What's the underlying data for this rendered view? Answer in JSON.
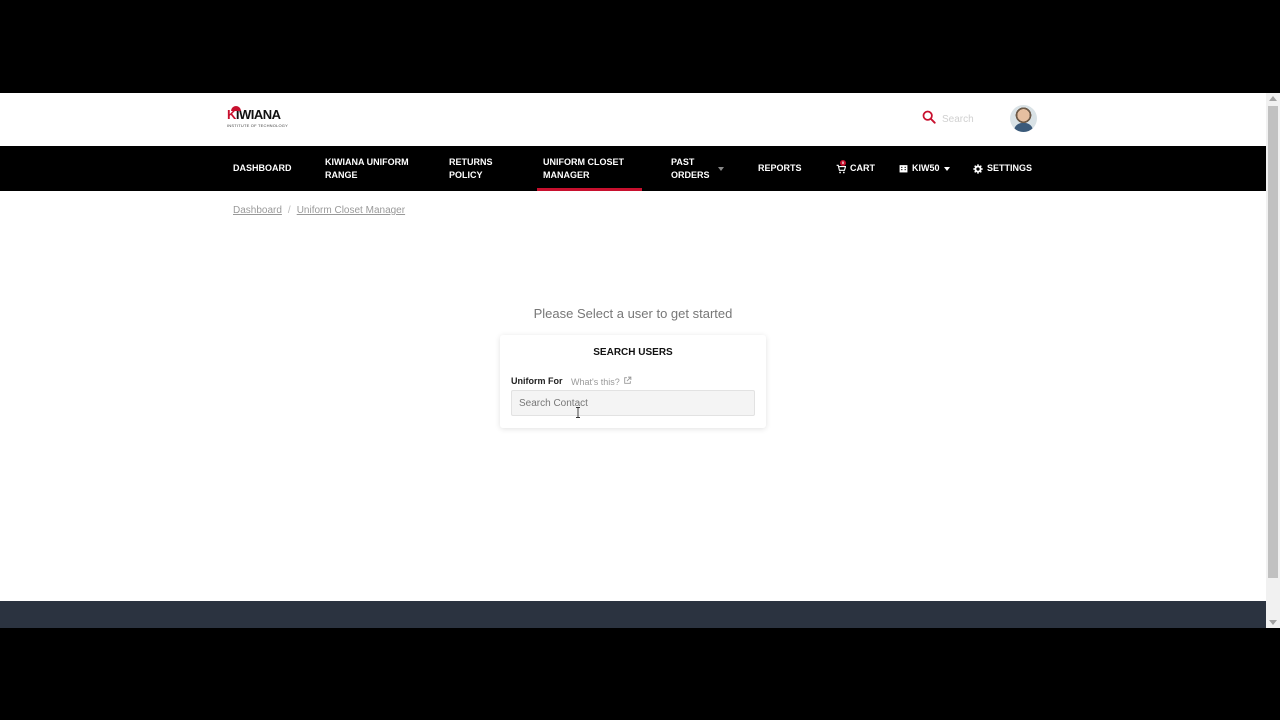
{
  "brand": {
    "name_k": "K",
    "name_rest": "IWIANA",
    "tagline": "INSTITUTE OF TECHNOLOGY",
    "accent": "#c8102e"
  },
  "header": {
    "search_placeholder": "Search",
    "search_icon": "search-icon",
    "avatar": "user-avatar"
  },
  "nav": {
    "items": [
      {
        "label": "DASHBOARD"
      },
      {
        "label": "KIWIANA UNIFORM\nRANGE"
      },
      {
        "label": "RETURNS\nPOLICY"
      },
      {
        "label": "UNIFORM CLOSET\nMANAGER",
        "active": true
      },
      {
        "label": "PAST\nORDERS",
        "dropdown": true
      },
      {
        "label": "REPORTS"
      },
      {
        "label": "CART",
        "icon": "cart-icon",
        "badge": "0"
      },
      {
        "label": "KIW50",
        "icon": "building-icon",
        "dropdown": true
      },
      {
        "label": "SETTINGS",
        "icon": "gear-icon"
      }
    ]
  },
  "breadcrumb": {
    "items": [
      "Dashboard",
      "Uniform Closet Manager"
    ],
    "separator": "/"
  },
  "main": {
    "prompt": "Please Select a user to get started",
    "card": {
      "title": "SEARCH USERS",
      "field_label": "Uniform For",
      "help_link": "What's this?",
      "input_placeholder": "Search Contact",
      "input_value": ""
    }
  },
  "colors": {
    "navbar": "#000000",
    "footer": "#2b3340",
    "accent": "#c8102e"
  }
}
